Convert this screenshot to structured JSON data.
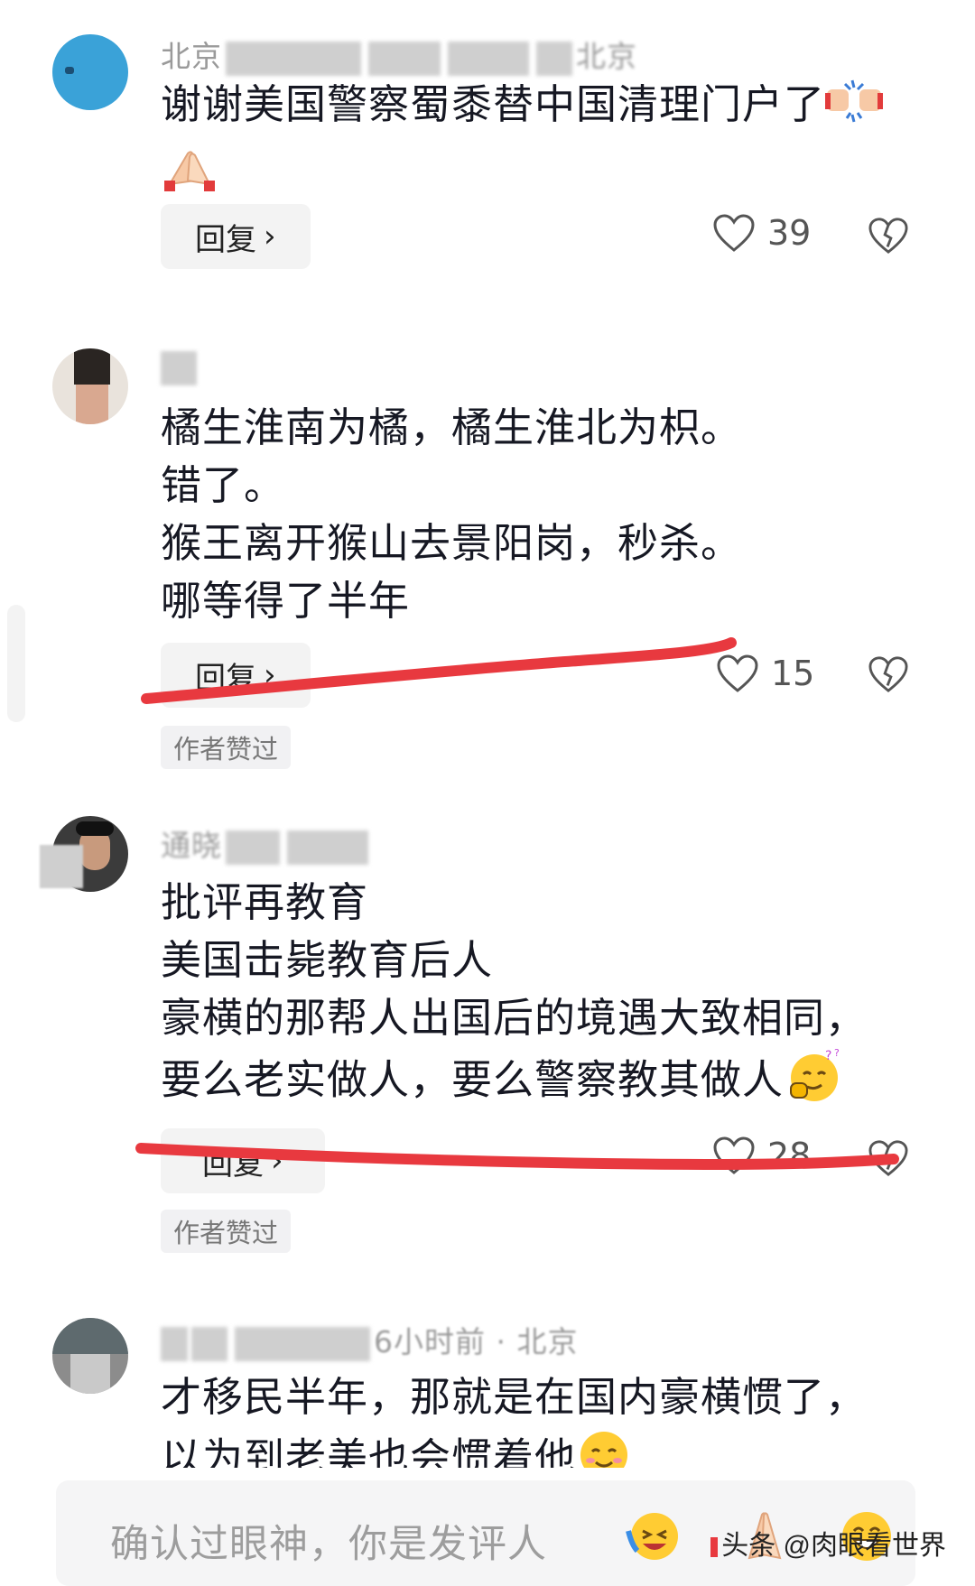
{
  "comments": [
    {
      "meta": "北京",
      "meta_end": "北京",
      "lines": [
        "谢谢美国警察蜀黍替中国清理门户了"
      ],
      "reply_label": "回复",
      "likes": "39",
      "author_liked": ""
    },
    {
      "meta": "",
      "lines": [
        "橘生淮南为橘，橘生淮北为枳。",
        "错了。",
        "猴王离开猴山去景阳岗，秒杀。",
        "哪等得了半年"
      ],
      "reply_label": "回复",
      "likes": "15",
      "author_liked": "作者赞过"
    },
    {
      "meta": "通晓",
      "lines": [
        "批评再教育",
        "美国击毙教育后人",
        "豪横的那帮人出国后的境遇大致相同，",
        "要么老实做人，要么警察教其做人"
      ],
      "reply_label": "回复",
      "likes": "28",
      "author_liked": "作者赞过"
    },
    {
      "meta": "",
      "meta_tail": "6小时前 · 北京",
      "lines": [
        "才移民半年，那就是在国内豪横惯了，",
        "以为到老美也会惯着他"
      ]
    }
  ],
  "input": {
    "placeholder": "确认过眼神，你是发评人"
  },
  "watermark": "头条 @肉眼看世界",
  "colors": {
    "annotation_red": "#e8393f",
    "text": "#161823",
    "muted": "#9a9a9a"
  }
}
